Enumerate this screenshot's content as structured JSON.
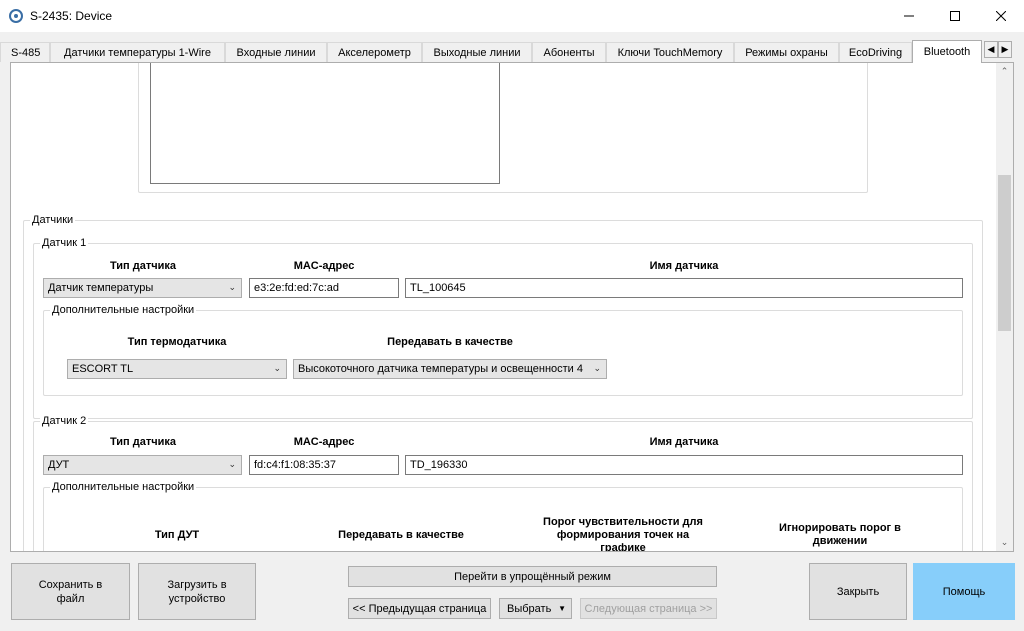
{
  "window": {
    "title": "S-2435: Device",
    "icon": "app-gear-icon"
  },
  "tabs": [
    {
      "label": "S-485"
    },
    {
      "label": "Датчики температуры 1-Wire"
    },
    {
      "label": "Входные линии"
    },
    {
      "label": "Акселерометр"
    },
    {
      "label": "Выходные линии"
    },
    {
      "label": "Абоненты"
    },
    {
      "label": "Ключи TouchMemory"
    },
    {
      "label": "Режимы охраны"
    },
    {
      "label": "EcoDriving"
    },
    {
      "label": "Bluetooth"
    }
  ],
  "active_tab": "Bluetooth",
  "sensors_group": {
    "title": "Датчики",
    "sensor1": {
      "title": "Датчик 1",
      "type_label": "Тип датчика",
      "mac_label": "MAC-адрес",
      "name_label": "Имя датчика",
      "type_value": "Датчик температуры",
      "mac_value": "e3:2e:fd:ed:7c:ad",
      "name_value": "TL_100645",
      "extra": {
        "title": "Дополнительные настройки",
        "thermo_type_label": "Тип термодатчика",
        "transmit_as_label": "Передавать в качестве",
        "thermo_type_value": "ESCORT TL",
        "transmit_as_value": "Высокоточного датчика температуры и освещенности 4"
      }
    },
    "sensor2": {
      "title": "Датчик 2",
      "type_label": "Тип датчика",
      "mac_label": "MAC-адрес",
      "name_label": "Имя датчика",
      "type_value": "ДУТ",
      "mac_value": "fd:c4:f1:08:35:37",
      "name_value": "TD_196330",
      "extra": {
        "title": "Дополнительные настройки",
        "dut_type_label": "Тип ДУТ",
        "transmit_as_label": "Передавать в качестве",
        "threshold_label": "Порог чувствительности для формирования точек на графике",
        "ignore_label": "Игнорировать порог в движении"
      }
    }
  },
  "footer": {
    "save_to_file": "Сохранить в файл",
    "load_to_device": "Загрузить в устройство",
    "simple_mode": "Перейти в упрощённый режим",
    "prev_page": "<< Предыдущая страница",
    "select": "Выбрать",
    "next_page": "Следующая страница >>",
    "close": "Закрыть",
    "help": "Помощь"
  },
  "colors": {
    "help_button": "#87cefa",
    "window_bg": "#f0f0f0"
  }
}
